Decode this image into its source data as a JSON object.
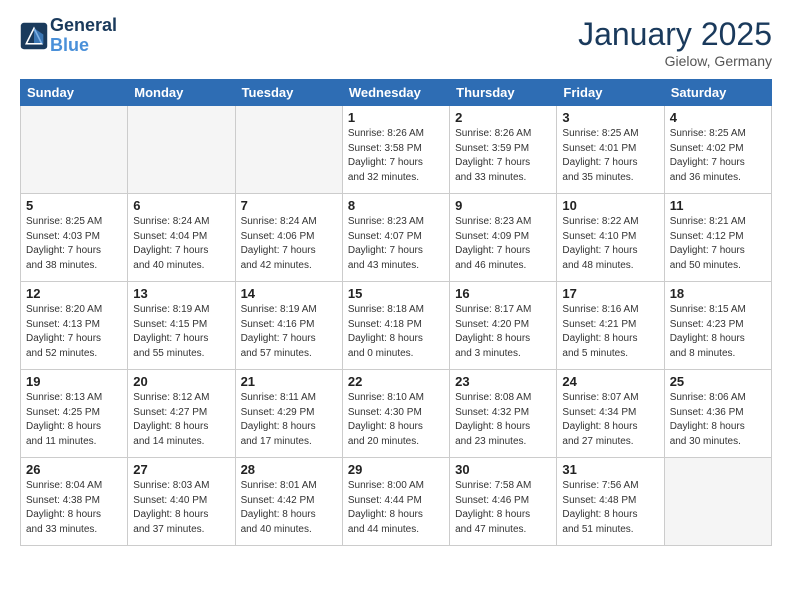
{
  "header": {
    "logo_line1": "General",
    "logo_line2": "Blue",
    "month": "January 2025",
    "location": "Gielow, Germany"
  },
  "weekdays": [
    "Sunday",
    "Monday",
    "Tuesday",
    "Wednesday",
    "Thursday",
    "Friday",
    "Saturday"
  ],
  "weeks": [
    [
      {
        "day": "",
        "info": ""
      },
      {
        "day": "",
        "info": ""
      },
      {
        "day": "",
        "info": ""
      },
      {
        "day": "1",
        "info": "Sunrise: 8:26 AM\nSunset: 3:58 PM\nDaylight: 7 hours\nand 32 minutes."
      },
      {
        "day": "2",
        "info": "Sunrise: 8:26 AM\nSunset: 3:59 PM\nDaylight: 7 hours\nand 33 minutes."
      },
      {
        "day": "3",
        "info": "Sunrise: 8:25 AM\nSunset: 4:01 PM\nDaylight: 7 hours\nand 35 minutes."
      },
      {
        "day": "4",
        "info": "Sunrise: 8:25 AM\nSunset: 4:02 PM\nDaylight: 7 hours\nand 36 minutes."
      }
    ],
    [
      {
        "day": "5",
        "info": "Sunrise: 8:25 AM\nSunset: 4:03 PM\nDaylight: 7 hours\nand 38 minutes."
      },
      {
        "day": "6",
        "info": "Sunrise: 8:24 AM\nSunset: 4:04 PM\nDaylight: 7 hours\nand 40 minutes."
      },
      {
        "day": "7",
        "info": "Sunrise: 8:24 AM\nSunset: 4:06 PM\nDaylight: 7 hours\nand 42 minutes."
      },
      {
        "day": "8",
        "info": "Sunrise: 8:23 AM\nSunset: 4:07 PM\nDaylight: 7 hours\nand 43 minutes."
      },
      {
        "day": "9",
        "info": "Sunrise: 8:23 AM\nSunset: 4:09 PM\nDaylight: 7 hours\nand 46 minutes."
      },
      {
        "day": "10",
        "info": "Sunrise: 8:22 AM\nSunset: 4:10 PM\nDaylight: 7 hours\nand 48 minutes."
      },
      {
        "day": "11",
        "info": "Sunrise: 8:21 AM\nSunset: 4:12 PM\nDaylight: 7 hours\nand 50 minutes."
      }
    ],
    [
      {
        "day": "12",
        "info": "Sunrise: 8:20 AM\nSunset: 4:13 PM\nDaylight: 7 hours\nand 52 minutes."
      },
      {
        "day": "13",
        "info": "Sunrise: 8:19 AM\nSunset: 4:15 PM\nDaylight: 7 hours\nand 55 minutes."
      },
      {
        "day": "14",
        "info": "Sunrise: 8:19 AM\nSunset: 4:16 PM\nDaylight: 7 hours\nand 57 minutes."
      },
      {
        "day": "15",
        "info": "Sunrise: 8:18 AM\nSunset: 4:18 PM\nDaylight: 8 hours\nand 0 minutes."
      },
      {
        "day": "16",
        "info": "Sunrise: 8:17 AM\nSunset: 4:20 PM\nDaylight: 8 hours\nand 3 minutes."
      },
      {
        "day": "17",
        "info": "Sunrise: 8:16 AM\nSunset: 4:21 PM\nDaylight: 8 hours\nand 5 minutes."
      },
      {
        "day": "18",
        "info": "Sunrise: 8:15 AM\nSunset: 4:23 PM\nDaylight: 8 hours\nand 8 minutes."
      }
    ],
    [
      {
        "day": "19",
        "info": "Sunrise: 8:13 AM\nSunset: 4:25 PM\nDaylight: 8 hours\nand 11 minutes."
      },
      {
        "day": "20",
        "info": "Sunrise: 8:12 AM\nSunset: 4:27 PM\nDaylight: 8 hours\nand 14 minutes."
      },
      {
        "day": "21",
        "info": "Sunrise: 8:11 AM\nSunset: 4:29 PM\nDaylight: 8 hours\nand 17 minutes."
      },
      {
        "day": "22",
        "info": "Sunrise: 8:10 AM\nSunset: 4:30 PM\nDaylight: 8 hours\nand 20 minutes."
      },
      {
        "day": "23",
        "info": "Sunrise: 8:08 AM\nSunset: 4:32 PM\nDaylight: 8 hours\nand 23 minutes."
      },
      {
        "day": "24",
        "info": "Sunrise: 8:07 AM\nSunset: 4:34 PM\nDaylight: 8 hours\nand 27 minutes."
      },
      {
        "day": "25",
        "info": "Sunrise: 8:06 AM\nSunset: 4:36 PM\nDaylight: 8 hours\nand 30 minutes."
      }
    ],
    [
      {
        "day": "26",
        "info": "Sunrise: 8:04 AM\nSunset: 4:38 PM\nDaylight: 8 hours\nand 33 minutes."
      },
      {
        "day": "27",
        "info": "Sunrise: 8:03 AM\nSunset: 4:40 PM\nDaylight: 8 hours\nand 37 minutes."
      },
      {
        "day": "28",
        "info": "Sunrise: 8:01 AM\nSunset: 4:42 PM\nDaylight: 8 hours\nand 40 minutes."
      },
      {
        "day": "29",
        "info": "Sunrise: 8:00 AM\nSunset: 4:44 PM\nDaylight: 8 hours\nand 44 minutes."
      },
      {
        "day": "30",
        "info": "Sunrise: 7:58 AM\nSunset: 4:46 PM\nDaylight: 8 hours\nand 47 minutes."
      },
      {
        "day": "31",
        "info": "Sunrise: 7:56 AM\nSunset: 4:48 PM\nDaylight: 8 hours\nand 51 minutes."
      },
      {
        "day": "",
        "info": ""
      }
    ]
  ]
}
